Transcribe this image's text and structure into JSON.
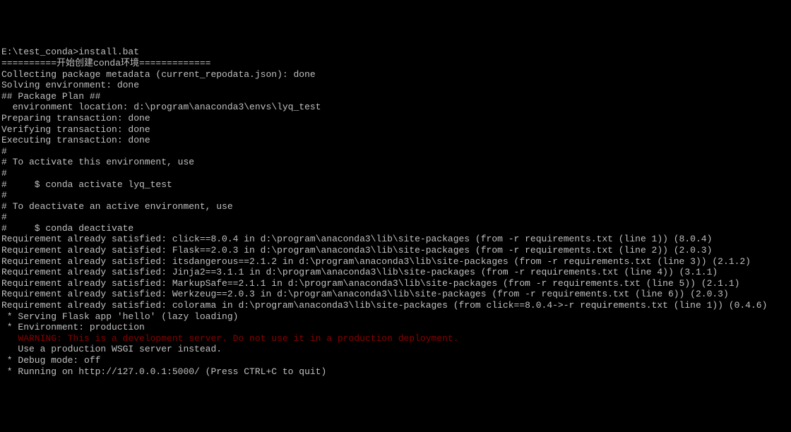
{
  "terminal": {
    "prompt": "E:\\test_conda>",
    "command": "install.bat",
    "lines": [
      "==========开始创建conda环境=============",
      "Collecting package metadata (current_repodata.json): done",
      "Solving environment: done",
      "",
      "## Package Plan ##",
      "",
      "  environment location: d:\\program\\anaconda3\\envs\\lyq_test",
      "",
      "",
      "",
      "Preparing transaction: done",
      "Verifying transaction: done",
      "Executing transaction: done",
      "#",
      "# To activate this environment, use",
      "#",
      "#     $ conda activate lyq_test",
      "#",
      "# To deactivate an active environment, use",
      "#",
      "#     $ conda deactivate",
      "",
      "Requirement already satisfied: click==8.0.4 in d:\\program\\anaconda3\\lib\\site-packages (from -r requirements.txt (line 1)) (8.0.4)",
      "Requirement already satisfied: Flask==2.0.3 in d:\\program\\anaconda3\\lib\\site-packages (from -r requirements.txt (line 2)) (2.0.3)",
      "Requirement already satisfied: itsdangerous==2.1.2 in d:\\program\\anaconda3\\lib\\site-packages (from -r requirements.txt (line 3)) (2.1.2)",
      "Requirement already satisfied: Jinja2==3.1.1 in d:\\program\\anaconda3\\lib\\site-packages (from -r requirements.txt (line 4)) (3.1.1)",
      "Requirement already satisfied: MarkupSafe==2.1.1 in d:\\program\\anaconda3\\lib\\site-packages (from -r requirements.txt (line 5)) (2.1.1)",
      "Requirement already satisfied: Werkzeug==2.0.3 in d:\\program\\anaconda3\\lib\\site-packages (from -r requirements.txt (line 6)) (2.0.3)",
      "Requirement already satisfied: colorama in d:\\program\\anaconda3\\lib\\site-packages (from click==8.0.4->-r requirements.txt (line 1)) (0.4.6)",
      " * Serving Flask app 'hello' (lazy loading)",
      " * Environment: production"
    ],
    "warning_line": "   WARNING: This is a development server. Do not use it in a production deployment.",
    "lines_after": [
      "   Use a production WSGI server instead.",
      " * Debug mode: off",
      " * Running on http://127.0.0.1:5000/ (Press CTRL+C to quit)"
    ]
  }
}
